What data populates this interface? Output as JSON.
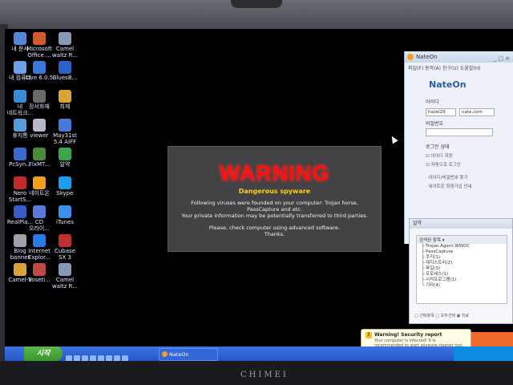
{
  "monitor": {
    "brand": "CHIMEI"
  },
  "desktop": {
    "icons": [
      {
        "label": "내 문서",
        "color": "#5a86d8"
      },
      {
        "label": "Microsoft\nOffice ...",
        "color": "#d45a2a"
      },
      {
        "label": "Camel\nwaltz R...",
        "color": "#8a98b8"
      },
      {
        "label": "내 컴퓨터",
        "color": "#6fa0e8"
      },
      {
        "label": "Live 6.0.5",
        "color": "#3a7ad6"
      },
      {
        "label": "BluesB...",
        "color": "#2b62c4"
      },
      {
        "label": "내\n네트워크...",
        "color": "#3a8ad6"
      },
      {
        "label": "장서화재",
        "color": "#6a6a6a"
      },
      {
        "label": "최제",
        "color": "#d8a43a"
      },
      {
        "label": "휴지통",
        "color": "#5a9ad8"
      },
      {
        "label": "viewer",
        "color": "#b8b8c8"
      },
      {
        "label": "May31st\n5.4 AIFF",
        "color": "#4a7ad8"
      },
      {
        "label": "PcSyn...",
        "color": "#3a6ad0"
      },
      {
        "label": "FlxMT...",
        "color": "#4a8a3a"
      },
      {
        "label": "알약",
        "color": "#3aa84a"
      },
      {
        "label": "Nero\nStartS...",
        "color": "#c02a2a"
      },
      {
        "label": "네이트온",
        "color": "#f0a020"
      },
      {
        "label": "Skype",
        "color": "#1aa0e8"
      },
      {
        "label": "RealPla...",
        "color": "#3a5ac8"
      },
      {
        "label": "CD\n오라이...",
        "color": "#5a7ad8"
      },
      {
        "label": "iTunes",
        "color": "#3a90e8"
      },
      {
        "label": "Blog\nbanner",
        "color": "#a0a0a8"
      },
      {
        "label": "Internet\nExplor...",
        "color": "#2a7ae0"
      },
      {
        "label": "Cubase\nSX 3",
        "color": "#c03030"
      },
      {
        "label": "Camel-1",
        "color": "#d8a43a"
      },
      {
        "label": "Voseti...",
        "color": "#c04a4a"
      },
      {
        "label": "Camel\nwaltz R...",
        "color": "#8a98b8"
      }
    ]
  },
  "popup": {
    "title": "WARNING",
    "subtitle": "Dangerous spyware",
    "line1": "Following viruses were founded on your computer: Trojan horse, PassCapture and etc.",
    "line2": "Your private information may be potentially transferred to third parties.",
    "line3": "Please, check computer using advanced software.",
    "line4": "Thanks."
  },
  "nateon": {
    "title": "NateOn",
    "menu": "파일(F)  동작(A)  친구(U)  도움말(H)",
    "logo": "NateOn",
    "id_label": "아이디",
    "id_value": "hazel29",
    "domain_value": "nate.com",
    "pw_label": "비밀번호",
    "login_label": "로그인 상태",
    "opt1": "☑ 아이디 저장",
    "opt2": "☑ 자동으로 로그인",
    "opt3": "· 아이디/비밀번호 찾기",
    "opt4": "· 네이트온 회원가입 안내"
  },
  "panel2": {
    "title": "알약",
    "header": "검색된 항목 ▾",
    "rows": [
      "├ Trojan.Agent.WWDC",
      "├ PassCapture",
      "├ 쿠키(1)",
      "├ 레지스트리(2)",
      "├ 파일(3)",
      "├ 프로세스(1)",
      "├ 시작프로그램(1)",
      "└ 기타(4)"
    ],
    "footer": "□ 선택항목  □ 모두선택  ▣ 치료"
  },
  "notification": {
    "title": "Warning! Security report",
    "message": "Your computer is infected! It is recommended to start spyware cleaner tool."
  },
  "taskbar": {
    "start_label": "시작",
    "task_label": "NateOn"
  }
}
